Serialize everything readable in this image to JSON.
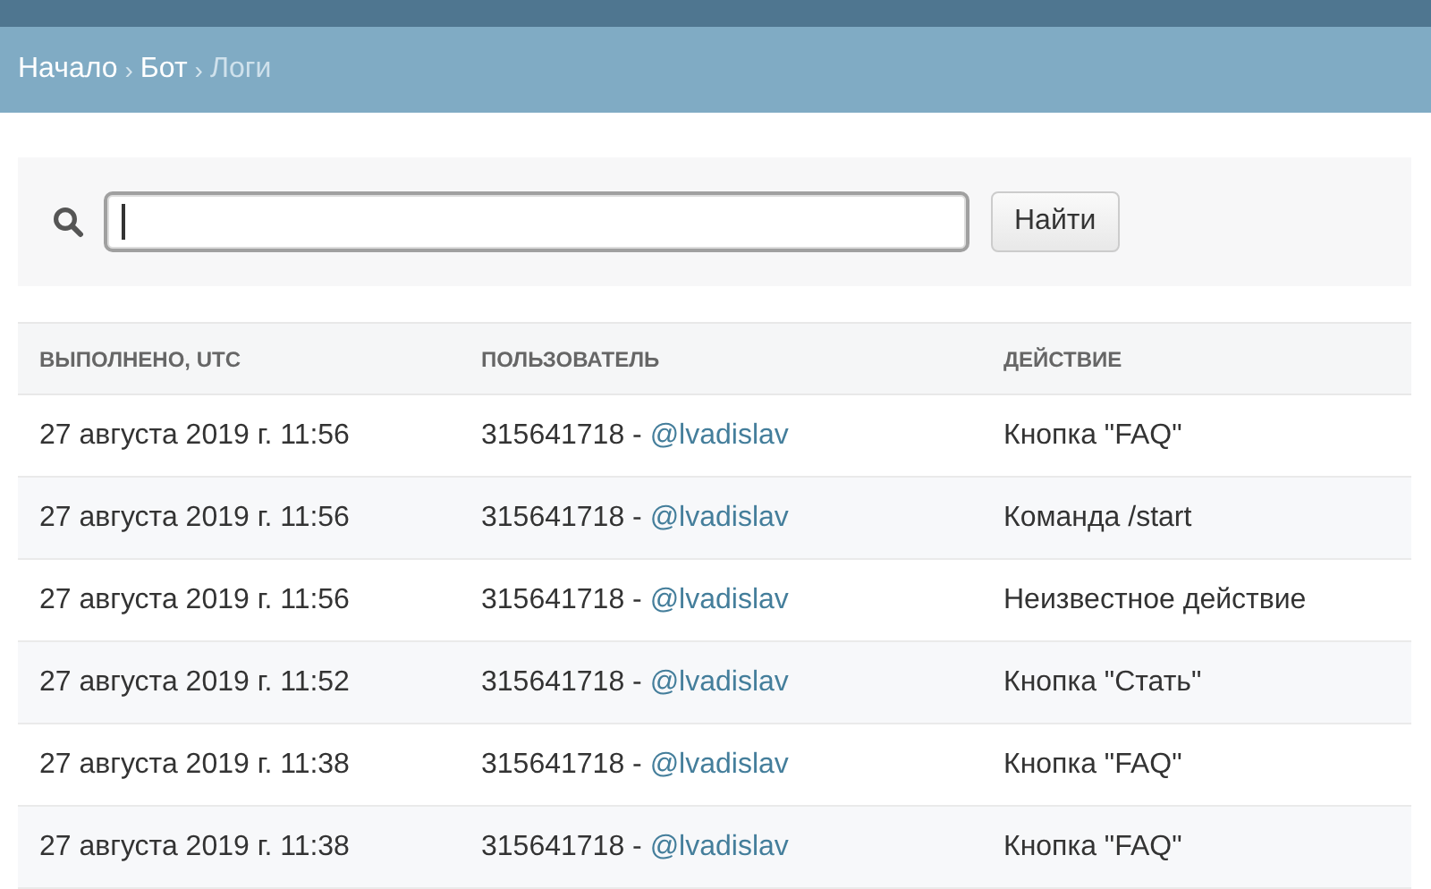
{
  "breadcrumbs": {
    "separator": "›",
    "items": [
      {
        "label": "Начало",
        "current": false
      },
      {
        "label": "Бот",
        "current": false
      },
      {
        "label": "Логи",
        "current": true
      }
    ]
  },
  "search": {
    "button": "Найти",
    "focused": true
  },
  "table": {
    "columns": [
      "ВЫПОЛНЕНО, UTC",
      "ПОЛЬЗОВАТЕЛЬ",
      "ДЕЙСТВИЕ"
    ],
    "rows": [
      {
        "time": "27 августа 2019 г. 11:56",
        "user_id": "315641718 -",
        "user_link": "@lvadislav",
        "action": "Кнопка \"FAQ\""
      },
      {
        "time": "27 августа 2019 г. 11:56",
        "user_id": "315641718 -",
        "user_link": "@lvadislav",
        "action": "Команда /start"
      },
      {
        "time": "27 августа 2019 г. 11:56",
        "user_id": "315641718 -",
        "user_link": "@lvadislav",
        "action": "Неизвестное действие"
      },
      {
        "time": "27 августа 2019 г. 11:52",
        "user_id": "315641718 -",
        "user_link": "@lvadislav",
        "action": "Кнопка \"Стать\""
      },
      {
        "time": "27 августа 2019 г. 11:38",
        "user_id": "315641718 -",
        "user_link": "@lvadislav",
        "action": "Кнопка \"FAQ\""
      },
      {
        "time": "27 августа 2019 г. 11:38",
        "user_id": "315641718 -",
        "user_link": "@lvadislav",
        "action": "Кнопка \"FAQ\""
      }
    ]
  }
}
